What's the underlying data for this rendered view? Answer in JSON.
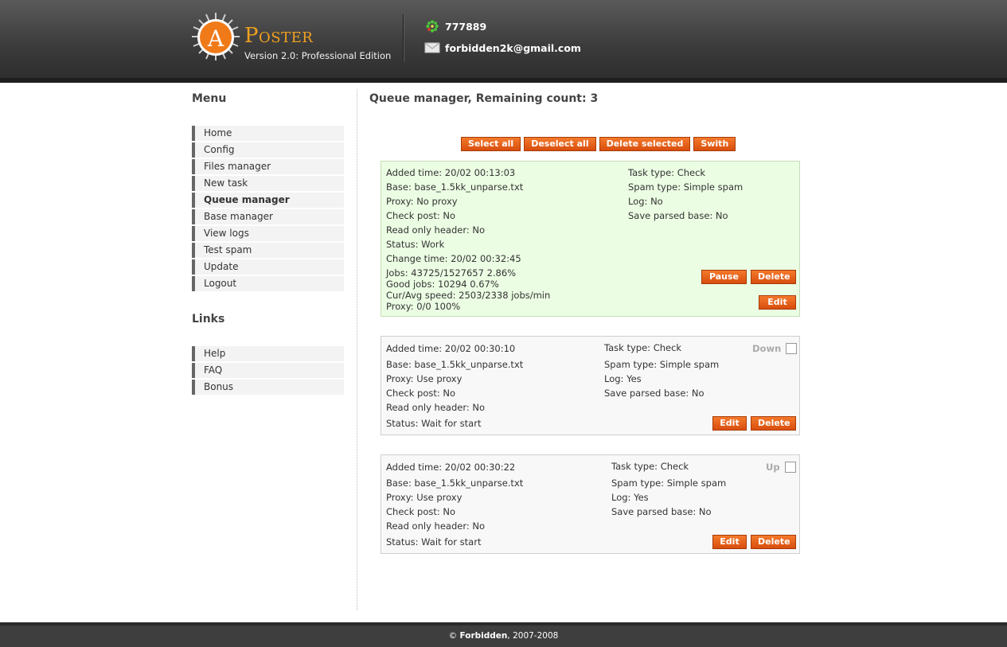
{
  "header": {
    "logo_letter": "A",
    "logo_word": "Poster",
    "version": "Version 2.0: Professional Edition",
    "icq": "777889",
    "email": "forbidden2k@gmail.com"
  },
  "sidebar": {
    "menu_title": "Menu",
    "menu": [
      "Home",
      "Config",
      "Files manager",
      "New task",
      "Queue manager",
      "Base manager",
      "View logs",
      "Test spam",
      "Update",
      "Logout"
    ],
    "active_menu": "Queue manager",
    "links_title": "Links",
    "links": [
      "Help",
      "FAQ",
      "Bonus"
    ]
  },
  "main": {
    "title": "Queue manager, Remaining count: 3",
    "toolbar": {
      "select_all": "Select all",
      "deselect_all": "Deselect all",
      "delete_selected": "Delete selected",
      "swith": "Swith"
    },
    "tasks": [
      {
        "added": "Added time: 20/02 00:13:03",
        "base": "Base: base_1.5kk_unparse.txt",
        "proxy": "Proxy: No proxy",
        "check_post": "Check post: No",
        "read_only_header": "Read only header: No",
        "status": "Status: Work",
        "change_time": "Change time: 20/02 00:32:45",
        "jobs": "Jobs: 43725/1527657 2.86%",
        "good_jobs": "Good jobs: 10294 0.67%",
        "speed": "Cur/Avg speed: 2503/2338 jobs/min",
        "proxy_stat": "Proxy: 0/0 100%",
        "task_type": "Task type: Check",
        "spam_type": "Spam type: Simple spam",
        "log": "Log: No",
        "save_parsed": "Save parsed base: No",
        "pause_label": "Pause",
        "delete_label": "Delete",
        "edit_label": "Edit"
      },
      {
        "added": "Added time: 20/02 00:30:10",
        "base": "Base: base_1.5kk_unparse.txt",
        "proxy": "Proxy: Use proxy",
        "check_post": "Check post: No",
        "read_only_header": "Read only header: No",
        "status": "Status: Wait for start",
        "task_type": "Task type: Check",
        "spam_type": "Spam type: Simple spam",
        "log": "Log: Yes",
        "save_parsed": "Save parsed base: No",
        "order_label": "Down",
        "edit_label": "Edit",
        "delete_label": "Delete"
      },
      {
        "added": "Added time: 20/02 00:30:22",
        "base": "Base: base_1.5kk_unparse.txt",
        "proxy": "Proxy: Use proxy",
        "check_post": "Check post: No",
        "read_only_header": "Read only header: No",
        "status": "Status: Wait for start",
        "task_type": "Task type: Check",
        "spam_type": "Spam type: Simple spam",
        "log": "Log: Yes",
        "save_parsed": "Save parsed base: No",
        "order_label": "Up",
        "edit_label": "Edit",
        "delete_label": "Delete"
      }
    ]
  },
  "footer": {
    "copyright_symbol": "©",
    "author": "Forbidden",
    "years": ", 2007-2008"
  }
}
